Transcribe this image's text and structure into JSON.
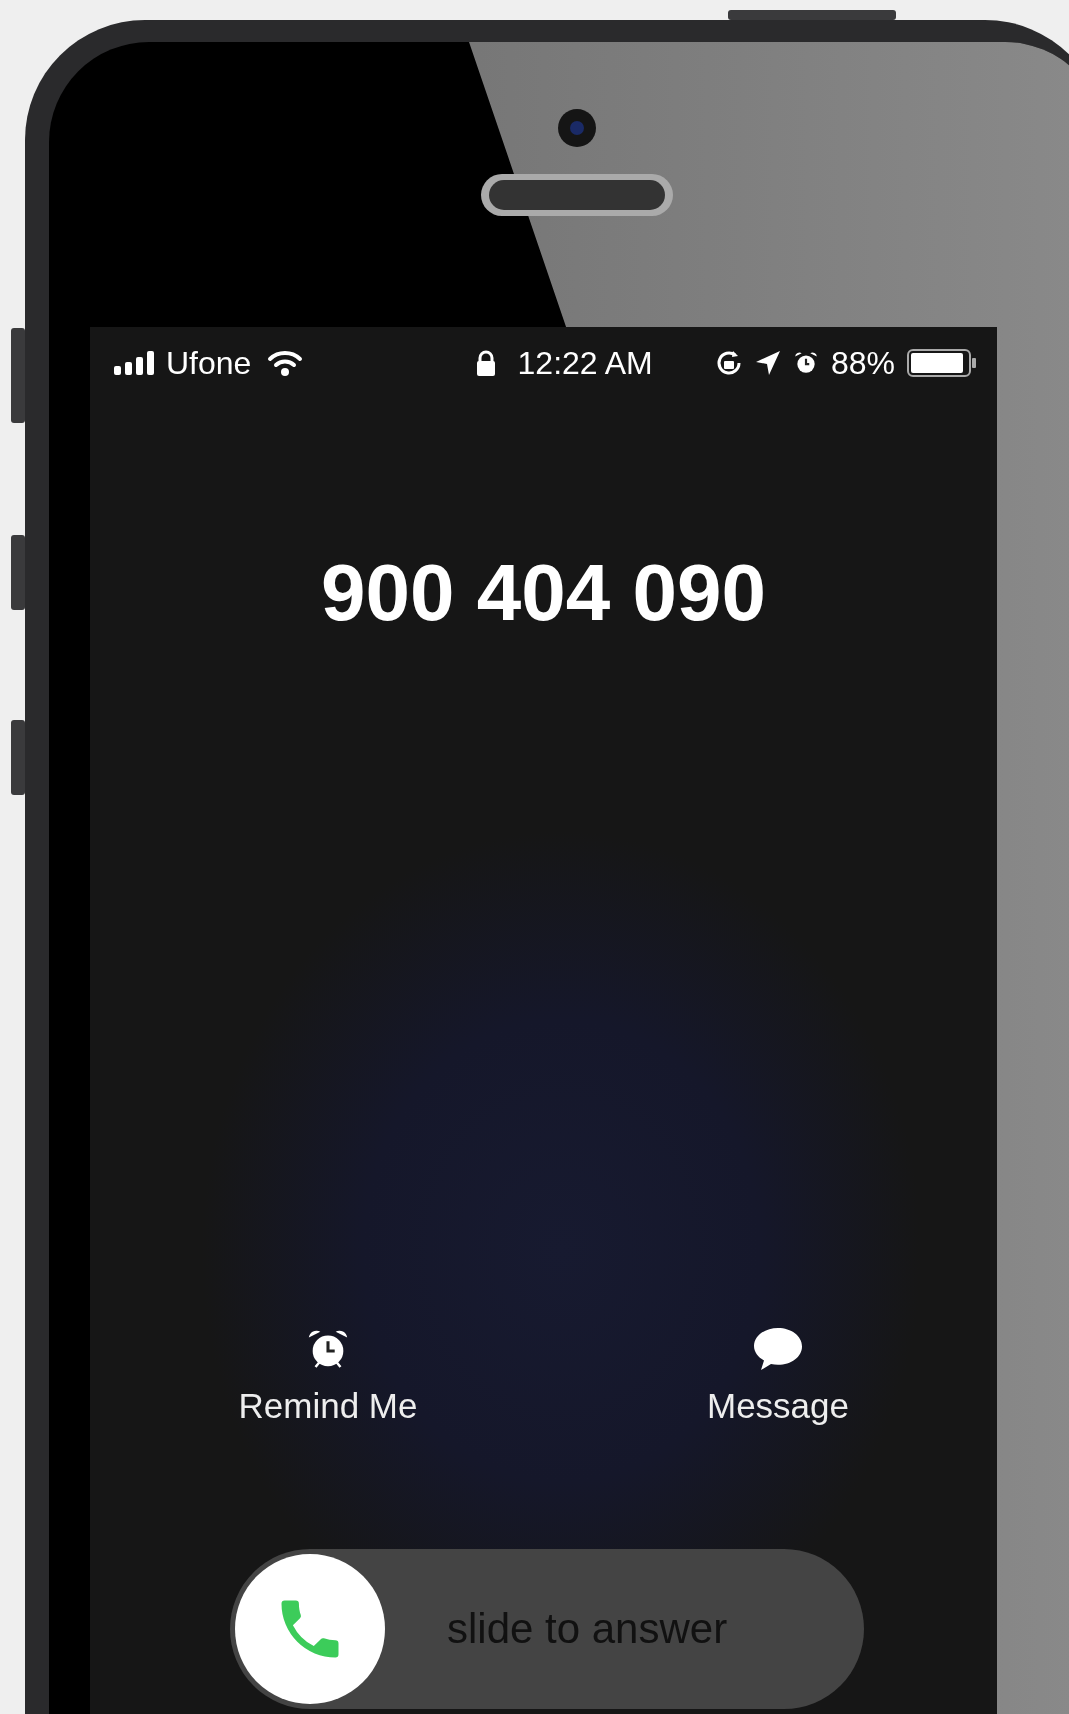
{
  "status_bar": {
    "carrier": "Ufone",
    "time": "12:22 AM",
    "battery": "88%"
  },
  "caller": {
    "number": "900 404 090"
  },
  "actions": [
    {
      "kind": "remind",
      "label": "Remind Me"
    },
    {
      "kind": "message",
      "label": "Message"
    }
  ],
  "slider": {
    "label": "slide to answer",
    "level": 0
  }
}
